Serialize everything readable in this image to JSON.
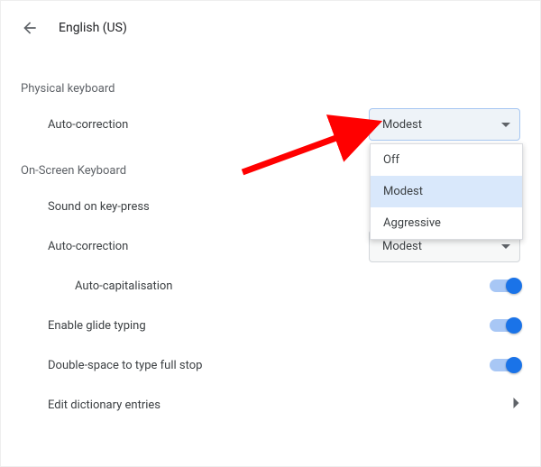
{
  "header": {
    "title": "English (US)"
  },
  "sections": {
    "physical": {
      "heading": "Physical keyboard",
      "auto_correction_label": "Auto-correction"
    },
    "onscreen": {
      "heading": "On-Screen Keyboard",
      "sound_label": "Sound on key-press",
      "auto_correction_label": "Auto-correction",
      "auto_cap_label": "Auto-capitalisation",
      "glide_label": "Enable glide typing",
      "double_space_label": "Double-space to type full stop",
      "dict_label": "Edit dictionary entries"
    }
  },
  "dropdown": {
    "selected": "Modest",
    "options": [
      "Off",
      "Modest",
      "Aggressive"
    ]
  },
  "second_dropdown_selected": "Modest",
  "colors": {
    "accent": "#1a73e8",
    "arrow": "#ff0000"
  }
}
